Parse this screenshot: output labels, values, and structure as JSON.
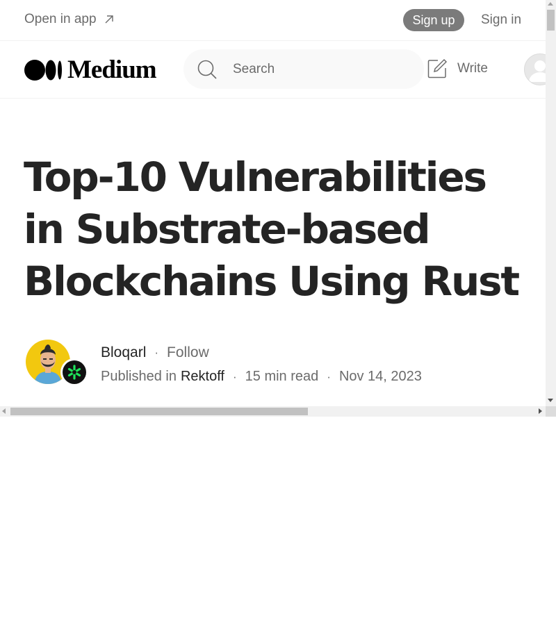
{
  "topbar": {
    "open_in_app_label": "Open in app",
    "signup_label": "Sign up",
    "signin_label": "Sign in"
  },
  "nav": {
    "logo_text": "Medium",
    "search": {
      "placeholder": "Search",
      "value": ""
    },
    "write_label": "Write"
  },
  "article": {
    "title": "Top-10 Vulnerabilities in Substrate-based Blockchains Using Rust",
    "author": "Bloqarl",
    "follow_label": "Follow",
    "published_in_label": "Published in",
    "publication": "Rektoff",
    "read_time": "15 min read",
    "date": "Nov 14, 2023",
    "separator": "·"
  },
  "icons": {
    "open_in_app": "arrow-up-right-icon",
    "search": "search-icon",
    "write": "write-icon",
    "user_avatar": "avatar-icon",
    "publication_badge": "rektoff-logo-icon"
  },
  "colors": {
    "text_primary": "#242424",
    "text_secondary": "#6b6b6b",
    "signup_bg": "#7b7b7b",
    "search_bg": "#f9f9f9",
    "author_avatar_bg": "#f2c80f",
    "badge_green": "#1ee35b"
  }
}
